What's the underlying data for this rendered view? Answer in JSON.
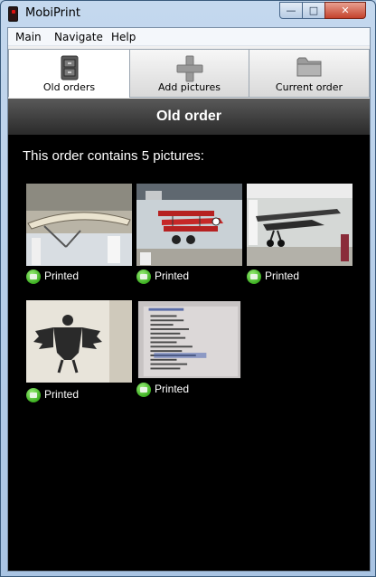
{
  "window": {
    "title": "MobiPrint"
  },
  "menu": {
    "items": [
      "Main",
      "Navigate",
      "Help"
    ]
  },
  "tabs": [
    {
      "label": "Old orders",
      "icon": "cabinet-icon",
      "active": true
    },
    {
      "label": "Add pictures",
      "icon": "plus-icon",
      "active": false
    },
    {
      "label": "Current order",
      "icon": "folder-icon",
      "active": false
    }
  ],
  "header": {
    "title": "Old order"
  },
  "summary": "This order contains 5 pictures:",
  "pictures": [
    {
      "status": "Printed",
      "subject": "glider-photo"
    },
    {
      "status": "Printed",
      "subject": "red-biplane-photo"
    },
    {
      "status": "Printed",
      "subject": "dark-monoplane-photo"
    },
    {
      "status": "Printed",
      "subject": "eagle-emblem-photo"
    },
    {
      "status": "Printed",
      "subject": "device-manager-screen-photo"
    }
  ],
  "colors": {
    "content_bg": "#000000",
    "status_icon": "#3cae21",
    "header_bg": "#3a3a3a"
  }
}
